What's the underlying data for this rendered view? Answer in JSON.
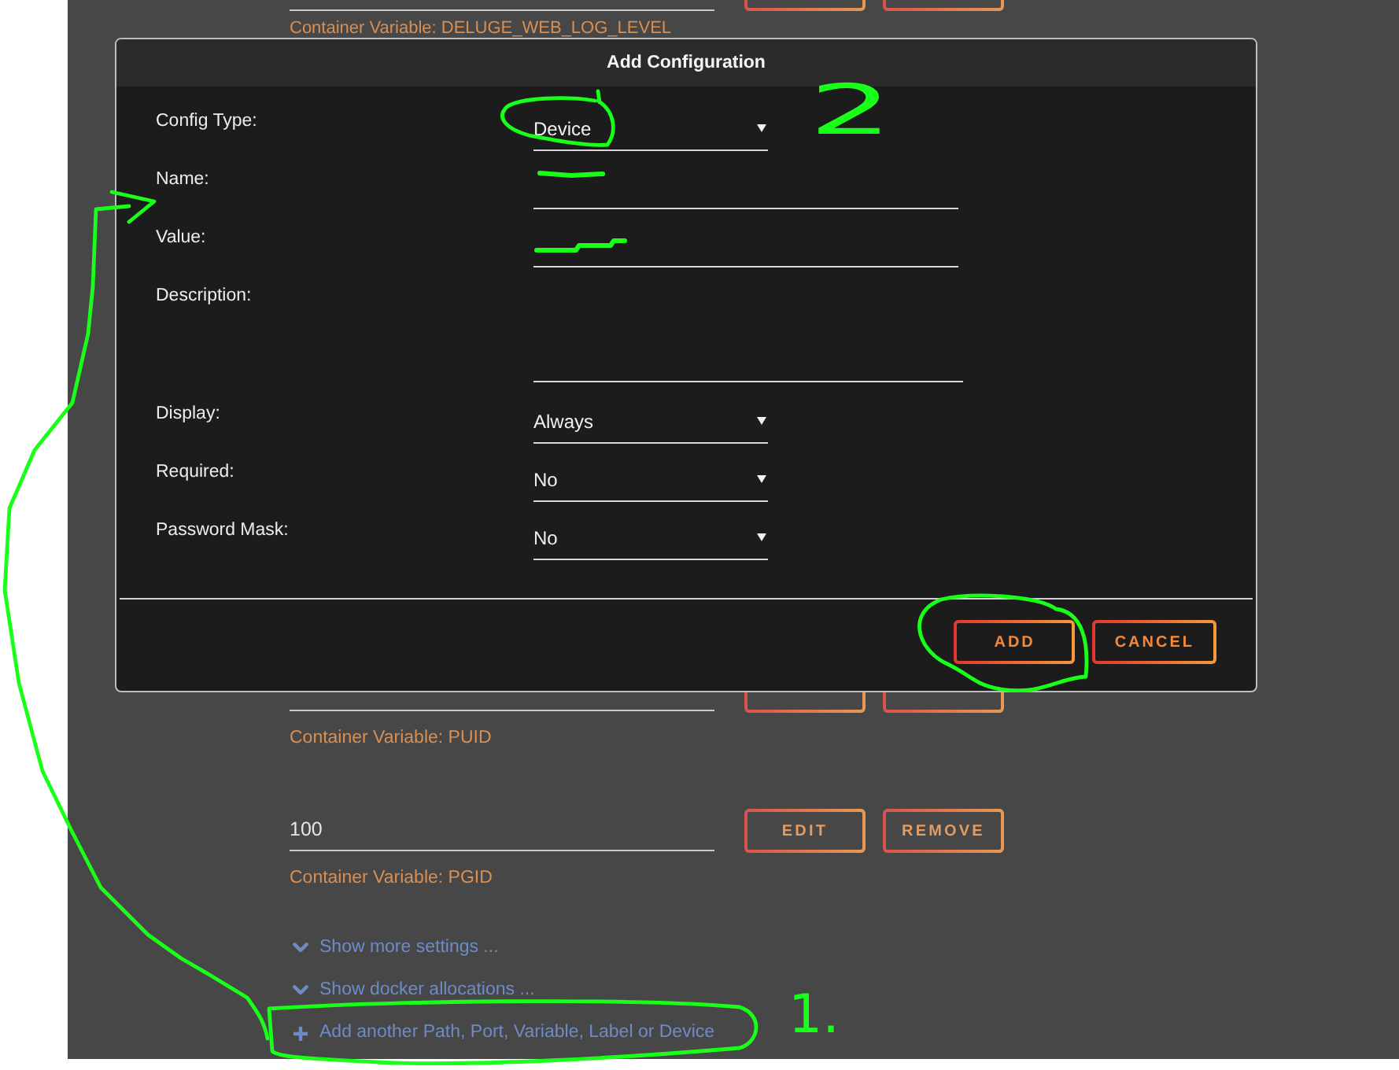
{
  "variables": [
    {
      "cut_off": true,
      "caption": "Container Variable: DELUGE_WEB_LOG_LEVEL"
    },
    {
      "cut_off": true,
      "caption": "Container Variable: PUID"
    },
    {
      "cut_off": false,
      "value": "100",
      "buttons": [
        "EDIT",
        "REMOVE"
      ],
      "caption": "Container Variable: PGID"
    }
  ],
  "links": [
    {
      "kind": "expand",
      "text": "Show more settings ..."
    },
    {
      "kind": "expand",
      "text": "Show docker allocations ..."
    },
    {
      "kind": "add",
      "text": "Add another Path, Port, Variable, Label or Device"
    }
  ],
  "dialog": {
    "title": "Add Configuration",
    "fields": [
      {
        "label": "Config Type:",
        "kind": "select",
        "value": "Device"
      },
      {
        "label": "Name:",
        "kind": "text"
      },
      {
        "label": "Value:",
        "kind": "text"
      },
      {
        "label": "Description:",
        "kind": "textarea"
      },
      {
        "label": "Display:",
        "kind": "select",
        "value": "Always"
      },
      {
        "label": "Required:",
        "kind": "select",
        "value": "No"
      },
      {
        "label": "Password Mask:",
        "kind": "select",
        "value": "No"
      }
    ],
    "buttons": [
      "ADD",
      "CANCEL"
    ]
  },
  "annotations": [
    {
      "kind": "ring"
    },
    {
      "kind": "number",
      "text": "2"
    },
    {
      "kind": "scribble"
    },
    {
      "kind": "scribble"
    },
    {
      "kind": "ring"
    },
    {
      "kind": "arrow"
    },
    {
      "kind": "ring"
    },
    {
      "kind": "number",
      "text": "1."
    }
  ]
}
